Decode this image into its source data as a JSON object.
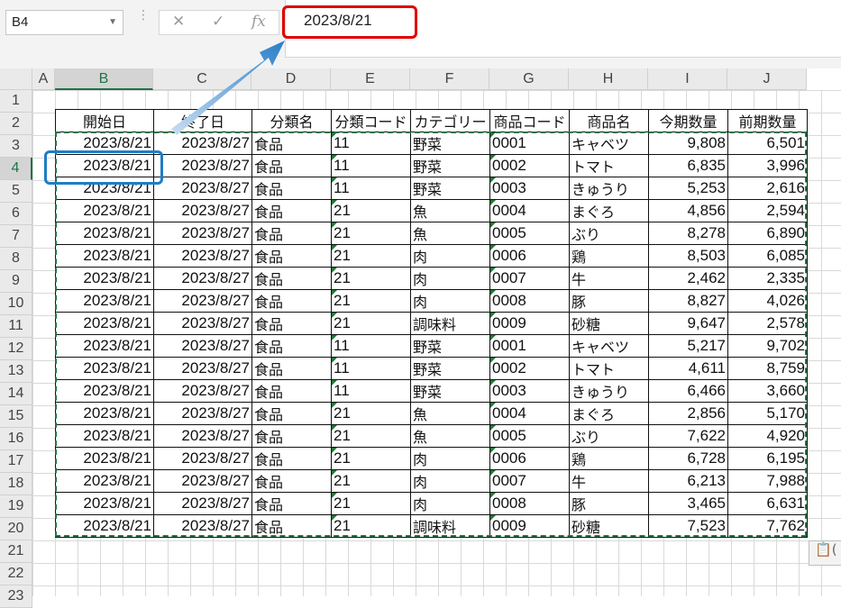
{
  "name_box": "B4",
  "formula_bar": {
    "fx": "fx",
    "cancel": "✕",
    "enter": "✓",
    "value": "2023/8/21"
  },
  "columns": [
    "A",
    "B",
    "C",
    "D",
    "E",
    "F",
    "G",
    "H",
    "I",
    "J"
  ],
  "rows": [
    "1",
    "2",
    "3",
    "4",
    "5",
    "6",
    "7",
    "8",
    "9",
    "10",
    "11",
    "12",
    "13",
    "14",
    "15",
    "16",
    "17",
    "18",
    "19",
    "20",
    "21",
    "22",
    "23"
  ],
  "table": {
    "headers": [
      "開始日",
      "終了日",
      "分類名",
      "分類コード",
      "カテゴリー",
      "商品コード",
      "商品名",
      "今期数量",
      "前期数量"
    ],
    "rows": [
      [
        "2023/8/21",
        "2023/8/27",
        "食品",
        "11",
        "野菜",
        "0001",
        "キャベツ",
        "9,808",
        "6,501"
      ],
      [
        "2023/8/21",
        "2023/8/27",
        "食品",
        "11",
        "野菜",
        "0002",
        "トマト",
        "6,835",
        "3,996"
      ],
      [
        "2023/8/21",
        "2023/8/27",
        "食品",
        "11",
        "野菜",
        "0003",
        "きゅうり",
        "5,253",
        "2,616"
      ],
      [
        "2023/8/21",
        "2023/8/27",
        "食品",
        "21",
        "魚",
        "0004",
        "まぐろ",
        "4,856",
        "2,594"
      ],
      [
        "2023/8/21",
        "2023/8/27",
        "食品",
        "21",
        "魚",
        "0005",
        "ぶり",
        "8,278",
        "6,890"
      ],
      [
        "2023/8/21",
        "2023/8/27",
        "食品",
        "21",
        "肉",
        "0006",
        "鶏",
        "8,503",
        "6,085"
      ],
      [
        "2023/8/21",
        "2023/8/27",
        "食品",
        "21",
        "肉",
        "0007",
        "牛",
        "2,462",
        "2,335"
      ],
      [
        "2023/8/21",
        "2023/8/27",
        "食品",
        "21",
        "肉",
        "0008",
        "豚",
        "8,827",
        "4,026"
      ],
      [
        "2023/8/21",
        "2023/8/27",
        "食品",
        "21",
        "調味料",
        "0009",
        "砂糖",
        "9,647",
        "2,578"
      ],
      [
        "2023/8/21",
        "2023/8/27",
        "食品",
        "11",
        "野菜",
        "0001",
        "キャベツ",
        "5,217",
        "9,702"
      ],
      [
        "2023/8/21",
        "2023/8/27",
        "食品",
        "11",
        "野菜",
        "0002",
        "トマト",
        "4,611",
        "8,759"
      ],
      [
        "2023/8/21",
        "2023/8/27",
        "食品",
        "11",
        "野菜",
        "0003",
        "きゅうり",
        "6,466",
        "3,660"
      ],
      [
        "2023/8/21",
        "2023/8/27",
        "食品",
        "21",
        "魚",
        "0004",
        "まぐろ",
        "2,856",
        "5,170"
      ],
      [
        "2023/8/21",
        "2023/8/27",
        "食品",
        "21",
        "魚",
        "0005",
        "ぶり",
        "7,622",
        "4,920"
      ],
      [
        "2023/8/21",
        "2023/8/27",
        "食品",
        "21",
        "肉",
        "0006",
        "鶏",
        "6,728",
        "6,195"
      ],
      [
        "2023/8/21",
        "2023/8/27",
        "食品",
        "21",
        "肉",
        "0007",
        "牛",
        "6,213",
        "7,988"
      ],
      [
        "2023/8/21",
        "2023/8/27",
        "食品",
        "21",
        "肉",
        "0008",
        "豚",
        "3,465",
        "6,631"
      ],
      [
        "2023/8/21",
        "2023/8/27",
        "食品",
        "21",
        "調味料",
        "0009",
        "砂糖",
        "7,523",
        "7,762"
      ]
    ]
  },
  "paste_options": "(",
  "colors": {
    "selection": "#217346",
    "callout_red": "#e10000",
    "callout_blue": "#1f7dc6",
    "arrow": "#2a7fc8"
  }
}
